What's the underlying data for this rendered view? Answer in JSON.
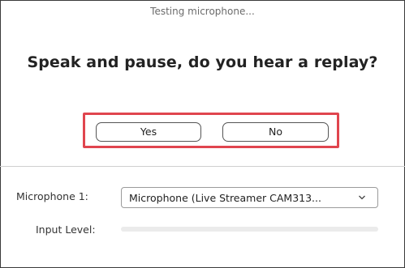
{
  "dialog": {
    "status": "Testing microphone...",
    "question": "Speak and pause, do you hear a replay?",
    "yes_label": "Yes",
    "no_label": "No"
  },
  "microphone": {
    "label": "Microphone 1:",
    "selected": "Microphone (Live Streamer CAM313..."
  },
  "input_level": {
    "label": "Input Level:",
    "level": 0
  },
  "colors": {
    "highlight": "#e0454e",
    "level_fill": "#2d8cff",
    "level_track": "#ebebeb"
  },
  "icons": {
    "dropdown": "chevron-down-icon"
  }
}
